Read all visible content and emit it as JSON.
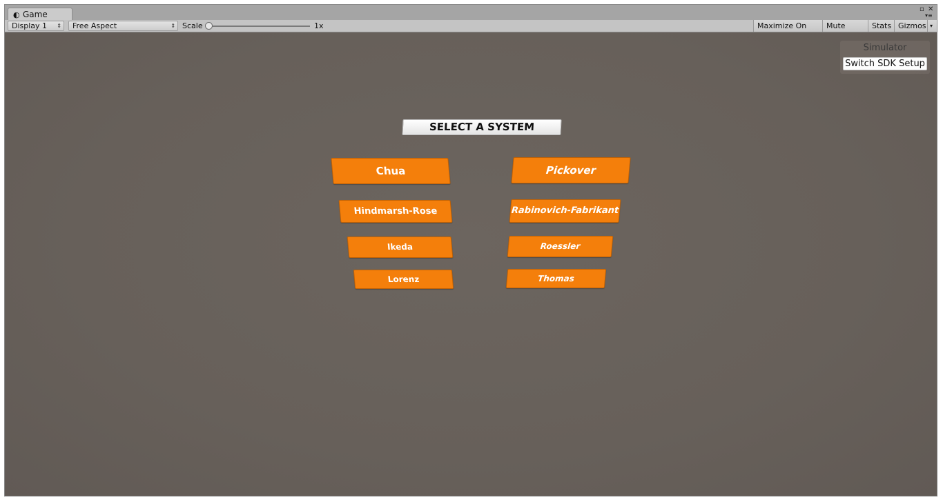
{
  "window": {
    "tab_label": "Game",
    "tab_icon": "unity-logo-icon",
    "controls": {
      "maximize_glyph": "▫",
      "close_glyph": "✕",
      "menu_glyph": "▾≡"
    }
  },
  "toolbar": {
    "display": "Display 1",
    "aspect": "Free Aspect",
    "scale_label": "Scale",
    "scale_value": "1x",
    "scale_fraction": 0.0,
    "maximize_on_play": "Maximize On Play",
    "mute_audio": "Mute Audio",
    "stats": "Stats",
    "gizmos": "Gizmos",
    "dropdown_arrow": "⇕",
    "gizmos_arrow": "▾"
  },
  "simulator": {
    "title": "Simulator",
    "button": "Switch SDK Setup"
  },
  "menu": {
    "heading": "SELECT A SYSTEM",
    "left_systems": [
      "Chua",
      "Hindmarsh-Rose",
      "Ikeda",
      "Lorenz"
    ],
    "right_systems": [
      "Pickover",
      "Rabinovich-Fabrikant",
      "Roessler",
      "Thomas"
    ]
  },
  "colors": {
    "button_orange": "#f47f0b",
    "background": "#67605a"
  }
}
